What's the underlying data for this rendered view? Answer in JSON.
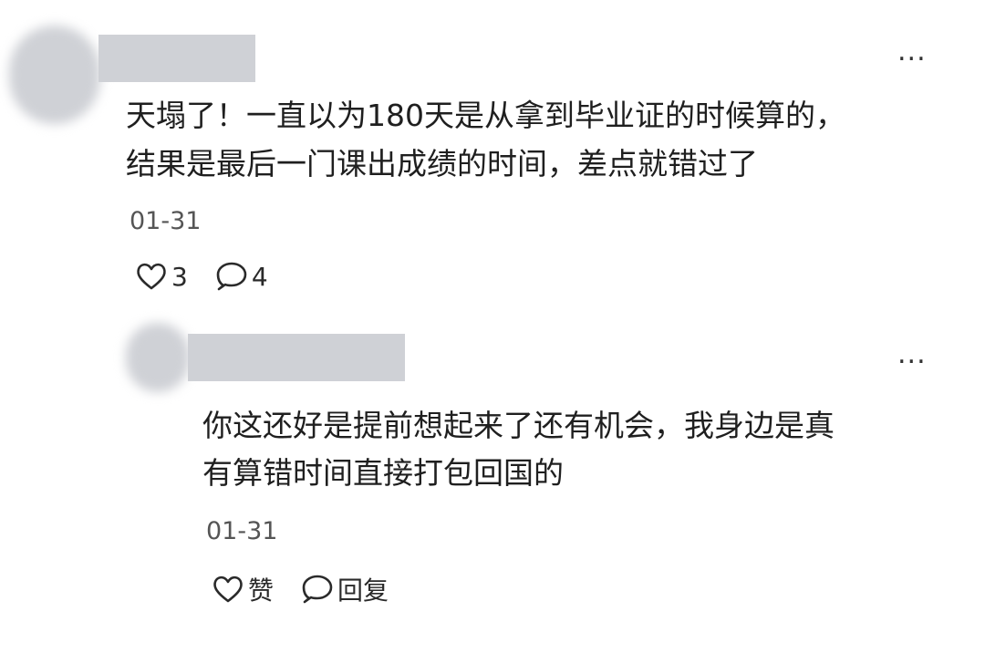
{
  "comments": [
    {
      "more_label": "...",
      "text_lines": [
        "天塌了！一直以为180天是从拿到毕业证的时候算的，",
        "结果是最后一门课出成绩的时间，差点就错过了"
      ],
      "date": "01-31",
      "like_count": "3",
      "reply_count": "4"
    },
    {
      "more_label": "...",
      "text_lines": [
        "你这还好是提前想起来了还有机会，我身边是真",
        "有算错时间直接打包回国的"
      ],
      "date": "01-31",
      "like_label": "赞",
      "reply_label": "回复"
    }
  ],
  "icons": {
    "like": "heart-outline-icon",
    "reply": "speech-bubble-icon"
  },
  "colors": {
    "redaction": "#cfd1d6",
    "text": "#1f1f1f",
    "meta": "#555555"
  }
}
